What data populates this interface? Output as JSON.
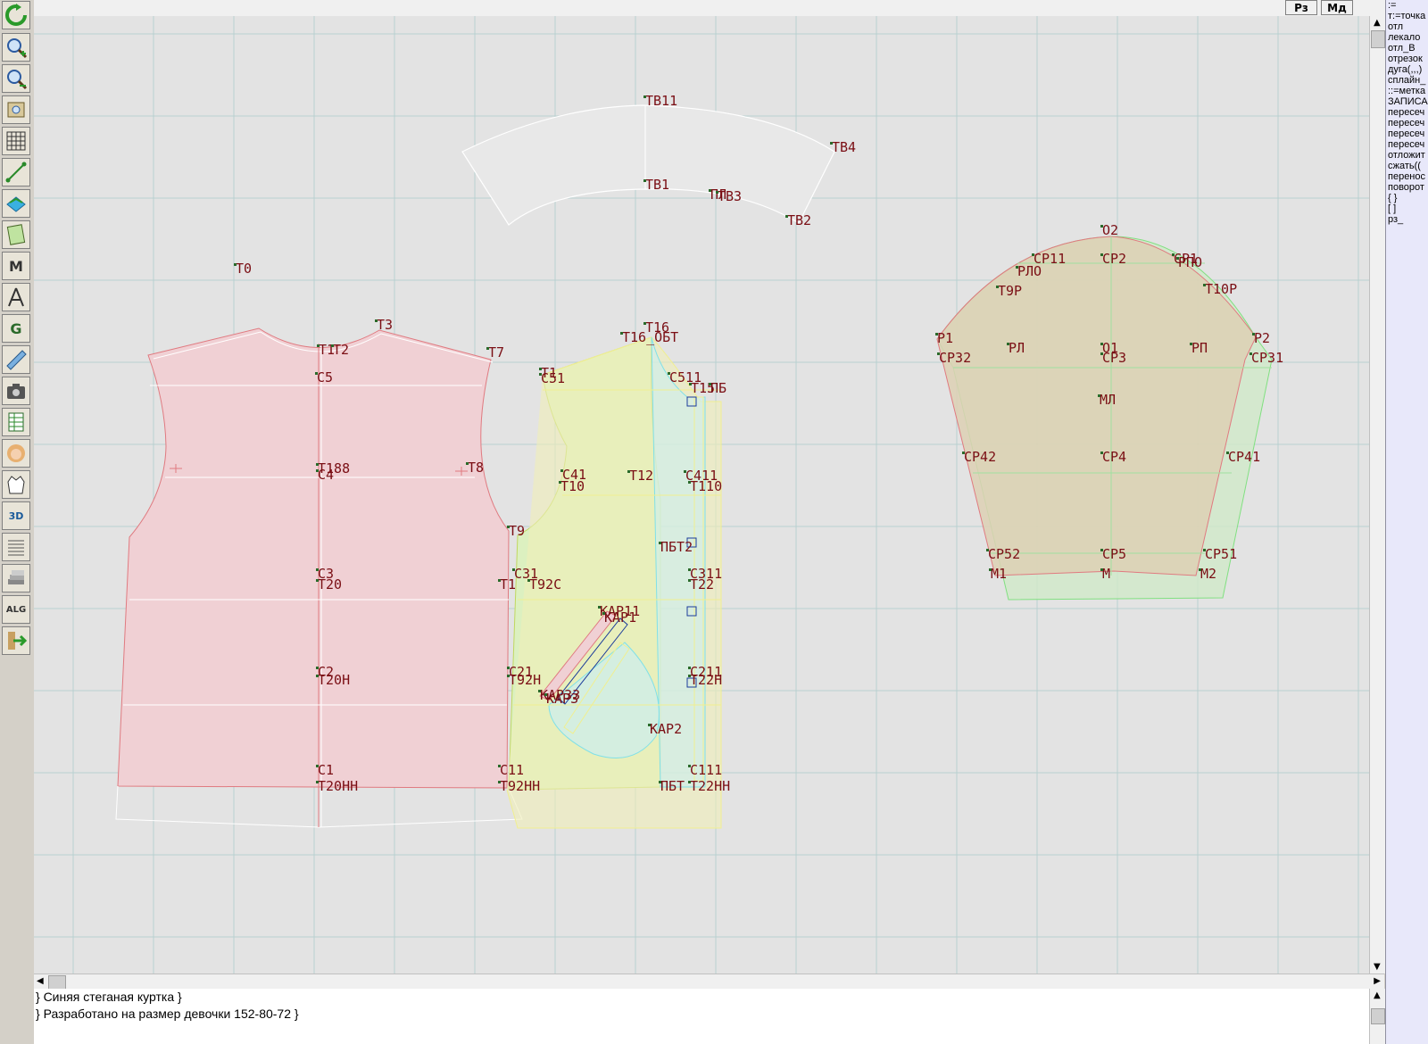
{
  "topbar": {
    "rz_label": "Рз",
    "md_label": "Мд"
  },
  "toolbar": {
    "tools": [
      {
        "icon": "refresh-icon"
      },
      {
        "icon": "zoom-in-icon"
      },
      {
        "icon": "zoom-out-icon"
      },
      {
        "icon": "zoom-fit-icon"
      },
      {
        "icon": "grid-icon"
      },
      {
        "icon": "line-tool-icon"
      },
      {
        "icon": "layer-icon"
      },
      {
        "icon": "pattern-icon"
      },
      {
        "icon": "measure-icon"
      },
      {
        "icon": "compass-icon"
      },
      {
        "icon": "curve-tool-icon"
      },
      {
        "icon": "ruler-icon"
      },
      {
        "icon": "camera-icon"
      },
      {
        "icon": "table-icon"
      },
      {
        "icon": "face-icon"
      },
      {
        "icon": "jacket-icon"
      },
      {
        "icon": "3d-view-icon"
      },
      {
        "icon": "document-icon"
      },
      {
        "icon": "stack-icon"
      },
      {
        "icon": "algorithm-icon"
      },
      {
        "icon": "exit-icon"
      }
    ],
    "tool_letters": {
      "measure": "M",
      "curve": "G",
      "three_d": "3D",
      "alg": "ALG"
    }
  },
  "right_panel": {
    "lines": [
      ":=",
      "т:=точка",
      "отл",
      "лекало",
      "отл_В",
      "отрезок",
      "дуга(,,,)",
      "сплайн_",
      "::=метка",
      "ЗАПИСА",
      "пересеч",
      "пересеч",
      "пересеч",
      "пересеч",
      "отложит",
      "сжать((",
      "перенос",
      "поворот",
      "{ }",
      "[ ]",
      "рз_"
    ]
  },
  "status": {
    "line1": "} Синяя стеганая куртка }",
    "line2": "} Разработано на размер девочки 152-80-72 }"
  },
  "colors": {
    "canvas_bg": "#e3e3e3",
    "grid": "#b8d0d0",
    "back_fill": "#f0d0d4",
    "front_fill": "#dcf0c0",
    "sleeve_fill": "#ddd0b4",
    "label": "#7a0e14"
  },
  "labels": [
    "ТВ11",
    "ТВ4",
    "ТВ1",
    "ПЛ",
    "ТВ3",
    "ТВ2",
    "Т0",
    "Т3",
    "Т1",
    "Т2",
    "Т7",
    "С5",
    "Т16",
    "Т16_ОБТ",
    "С51",
    "С511",
    "Т1",
    "Т15",
    "ПБ",
    "Т188",
    "С4",
    "Т8",
    "С41",
    "Т12",
    "С411",
    "Т10",
    "Т110",
    "Т9",
    "ПБТ2",
    "С3",
    "Т20",
    "С31",
    "Т92С",
    "Т1",
    "С311",
    "Т22",
    "КАР11",
    "КАР1",
    "С2",
    "Т20Н",
    "С21",
    "Т92Н",
    "С211",
    "Т22Н",
    "КАР33",
    "КАР3",
    "КАР2",
    "С1",
    "Т20НН",
    "С11",
    "Т92НН",
    "С111",
    "ПБТ",
    "Т22НН",
    "О2",
    "СР11",
    "СР2",
    "СР1",
    "РЛО",
    "РПО",
    "Т9Р",
    "Т10Р",
    "Р1",
    "СР32",
    "РЛ",
    "О1",
    "СР3",
    "РП",
    "Р2",
    "СР31",
    "МЛ",
    "СР42",
    "СР4",
    "СР41",
    "СР52",
    "СР5",
    "СР51",
    "М1",
    "М",
    "М2"
  ]
}
